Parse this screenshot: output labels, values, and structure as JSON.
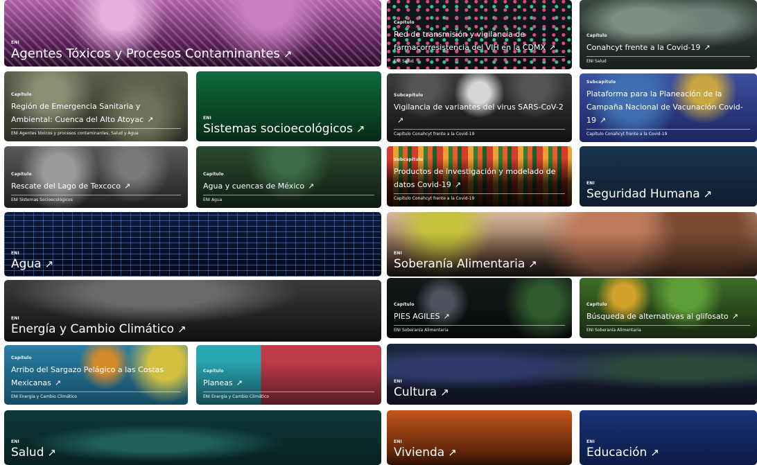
{
  "colors": {
    "green": "#0e6b3c",
    "navy": "#1a3550",
    "orange": "#c4561a",
    "blue": "#18347a",
    "purple": "#8a3f85"
  },
  "cards": {
    "toxicos": {
      "tag": "ENI",
      "title": "Agentes Tóxicos y Procesos Contaminantes",
      "arrow": "↗"
    },
    "vih": {
      "tag": "Capítulo",
      "title": "Red de transmisión y vigilancia de farmacorresistencia del VIH en la CDMX",
      "arrow": "↗",
      "foot": "ENI Salud"
    },
    "covid": {
      "tag": "Capítulo",
      "title": "Conahcyt frente a la Covid-19",
      "arrow": "↗",
      "foot": "ENI Salud"
    },
    "atoyac": {
      "tag": "Capítulo",
      "title": "Región de Emergencia Sanitaria y Ambiental: Cuenca del Alto Atoyac",
      "arrow": "↗",
      "foot": "ENI Agentes tóxicos y procesos contaminantes, Salud y Agua"
    },
    "socioeco": {
      "tag": "ENI",
      "title": "Sistemas socioecológicos",
      "arrow": "↗"
    },
    "variantes": {
      "tag": "Subcapítulo",
      "title": "Vigilancia de variantes del virus SARS-CoV-2",
      "arrow": "↗",
      "foot": "Capítulo Conahcyt frente a la Covid-19"
    },
    "vacunacion": {
      "tag": "Subcapítulo",
      "title": "Plataforma para la Planeación de la Campaña Nacional de Vacunación Covid-19",
      "arrow": "↗",
      "foot": "Capítulo Conahcyt frente a la Covid-19"
    },
    "texcoco": {
      "tag": "Capítulo",
      "title": "Rescate del Lago de Texcoco",
      "arrow": "↗",
      "foot": "ENI Sistemas Socioecológicos"
    },
    "cuencas": {
      "tag": "Capítulo",
      "title": "Agua y cuencas de México",
      "arrow": "↗",
      "foot": "ENI Agua"
    },
    "productos": {
      "tag": "Subcapítulo",
      "title": "Productos de investigación y modelado de datos Covid-19",
      "arrow": "↗",
      "foot": "Capítulo Conahcyt frente a la Covid-19"
    },
    "seguridad": {
      "tag": "ENI",
      "title": "Seguridad Humana",
      "arrow": "↗"
    },
    "agua": {
      "tag": "ENI",
      "title": "Agua",
      "arrow": "↗"
    },
    "soberania": {
      "tag": "ENI",
      "title": "Soberanía Alimentaria",
      "arrow": "↗"
    },
    "energia": {
      "tag": "ENI",
      "title": "Energía y Cambio Climático",
      "arrow": "↗"
    },
    "pies": {
      "tag": "Capítulo",
      "title": "PIES AGILES",
      "arrow": "↗",
      "foot": "ENI Soberanía Alimentaria"
    },
    "glifosato": {
      "tag": "Capítulo",
      "title": "Búsqueda de alternativas al glifosato",
      "arrow": "↗",
      "foot": "ENI Soberanía Alimentaria"
    },
    "sargazo": {
      "tag": "Capítulo",
      "title": "Arribo del Sargazo Pelágico a las Costas Mexicanas",
      "arrow": "↗",
      "foot": "ENI Energía y Cambio Climático"
    },
    "planeas": {
      "tag": "Capítulo",
      "title": "Planeas",
      "arrow": "↗",
      "foot": "ENI Energía y Cambio Climático"
    },
    "cultura": {
      "tag": "ENI",
      "title": "Cultura",
      "arrow": "↗"
    },
    "salud": {
      "tag": "ENI",
      "title": "Salud",
      "arrow": "↗"
    },
    "vivienda": {
      "tag": "ENI",
      "title": "Vivienda",
      "arrow": "↗"
    },
    "educacion": {
      "tag": "ENI",
      "title": "Educación",
      "arrow": "↗"
    }
  }
}
